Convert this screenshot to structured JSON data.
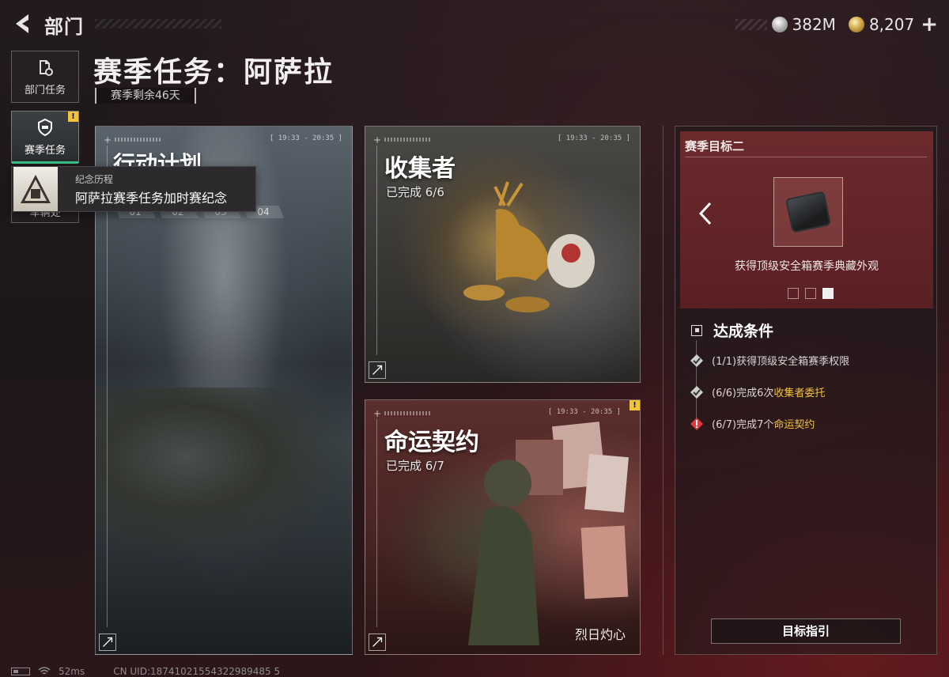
{
  "header": {
    "title": "部门",
    "currency": [
      {
        "icon": "silver-coin-icon",
        "value": "382M"
      },
      {
        "icon": "gold-coin-icon",
        "value": "8,207"
      }
    ],
    "add_label": "+"
  },
  "sidebar": {
    "items": [
      {
        "label": "部门任务",
        "icon": "document-icon"
      },
      {
        "label": "赛季任务",
        "icon": "shield-emblem-icon",
        "badge": "!"
      },
      {
        "label": "车辆处",
        "icon": "vehicle-icon"
      }
    ]
  },
  "tooltip": {
    "subtitle": "纪念历程",
    "text": "阿萨拉赛季任务加时赛纪念"
  },
  "page": {
    "title": "赛季任务：阿萨拉",
    "days_left": "赛季剩余46天"
  },
  "cards": {
    "plan": {
      "title": "行动计划",
      "time": "[ 19:33 - 20:35 ]",
      "steps": [
        "01",
        "02",
        "03",
        "04"
      ]
    },
    "collector": {
      "title": "收集者",
      "progress": "已完成 6/6",
      "time": "[ 19:33 - 20:35 ]"
    },
    "fate": {
      "title": "命运契约",
      "progress": "已完成 6/7",
      "time": "[ 19:33 - 20:35 ]",
      "badge": "!",
      "caption": "烈日灼心"
    }
  },
  "right_panel": {
    "title": "赛季目标二",
    "item_caption": "获得顶级安全箱赛季典藏外观",
    "conditions_title": "达成条件",
    "conditions": [
      {
        "prefix": "(1/1)获得顶级安全箱赛季权限",
        "highlight": "",
        "status": "done"
      },
      {
        "prefix": "(6/6)完成6次",
        "highlight": "收集者委托",
        "status": "done"
      },
      {
        "prefix": "(6/7)完成7个",
        "highlight": "命运契约",
        "status": "warning"
      }
    ],
    "guide_button": "目标指引",
    "colors": {
      "panel": "#6c2a2d",
      "highlight": "#f1c23b",
      "warning": "#e03a3a",
      "selected": "#3cc488"
    }
  },
  "status_bar": {
    "ping": "52ms",
    "uid": "CN UID:18741021554322989485 5"
  }
}
